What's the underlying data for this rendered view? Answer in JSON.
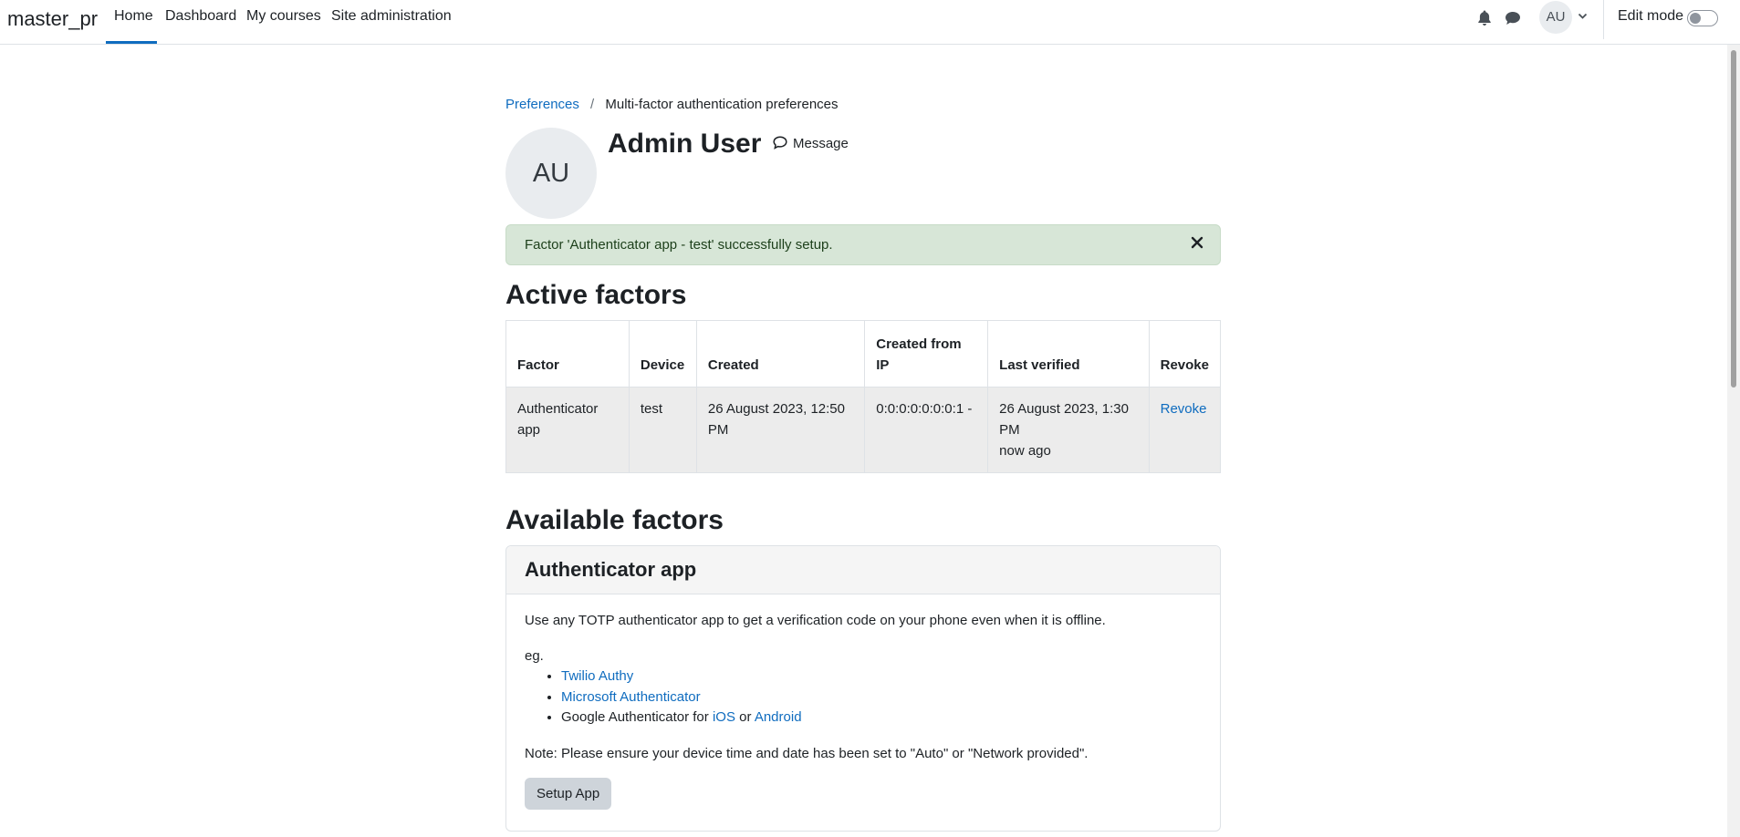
{
  "navbar": {
    "brand": "master_pr",
    "items": [
      {
        "label": "Home",
        "active": true
      },
      {
        "label": "Dashboard"
      },
      {
        "label": "My courses"
      },
      {
        "label": "Site administration"
      }
    ],
    "avatar_initials": "AU",
    "edit_mode_label": "Edit mode",
    "edit_mode_on": false,
    "icons": [
      "bell-icon",
      "chat-icon",
      "chevron-down-icon"
    ]
  },
  "breadcrumb": {
    "parent": "Preferences",
    "separator": "/",
    "current": "Multi-factor authentication preferences"
  },
  "profile": {
    "initials": "AU",
    "name": "Admin User",
    "message_label": "Message"
  },
  "alert": {
    "text": "Factor 'Authenticator app - test' successfully setup.",
    "type": "success"
  },
  "active_factors": {
    "heading": "Active factors",
    "columns": [
      "Factor",
      "Device",
      "Created",
      "Created from IP",
      "Last verified",
      "Revoke"
    ],
    "rows": [
      {
        "factor": "Authenticator app",
        "device": "test",
        "created": "26 August 2023, 12:50 PM",
        "created_from_ip": "0:0:0:0:0:0:0:1 -",
        "last_verified": "26 August 2023, 1:30 PM",
        "last_verified_relative": "now ago",
        "revoke_label": "Revoke"
      }
    ]
  },
  "available_factors": {
    "heading": "Available factors",
    "cards": [
      {
        "title": "Authenticator app",
        "description": "Use any TOTP authenticator app to get a verification code on your phone even when it is offline.",
        "eg_label": "eg.",
        "apps": {
          "twilio": "Twilio Authy",
          "microsoft": "Microsoft Authenticator",
          "google_prefix": "Google Authenticator for",
          "ios": "iOS",
          "or": "or",
          "android": "Android"
        },
        "note": "Note: Please ensure your device time and date has been set to \"Auto\" or \"Network provided\".",
        "button_label": "Setup App"
      }
    ]
  },
  "colors": {
    "link": "#0f6cbf",
    "alert_bg": "#d7e6d7",
    "alert_text": "#1c3f1a",
    "button_bg": "#ced4da"
  }
}
